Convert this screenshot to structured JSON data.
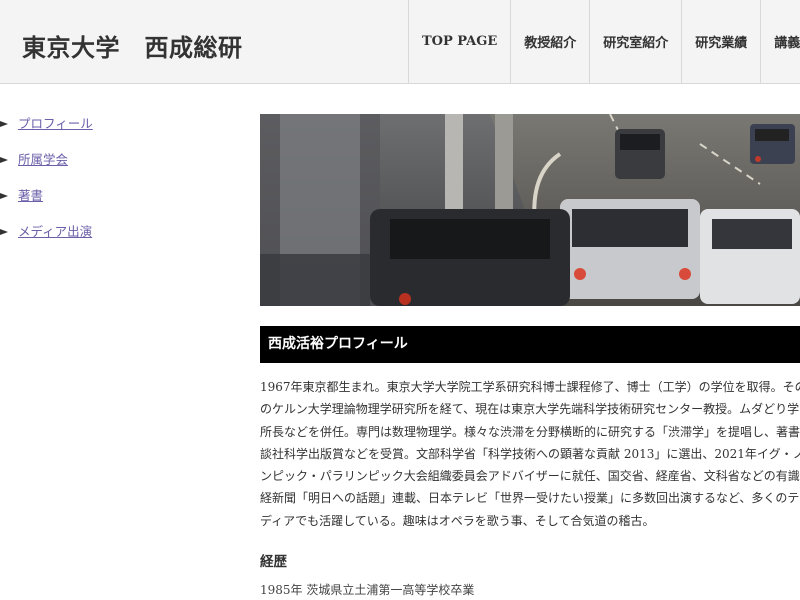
{
  "header": {
    "site_title": "東京大学　西成総研",
    "nav": [
      "TOP PAGE",
      "教授紹介",
      "研究室紹介",
      "研究業績",
      "講義"
    ]
  },
  "sidebar": {
    "items": [
      "プロフィール",
      "所属学会",
      "著書",
      "メディア出演"
    ]
  },
  "hero": {
    "image": "traffic-jam-highway-photo"
  },
  "profile": {
    "heading": "西成活裕プロフィール",
    "bio_lines": [
      "1967年東京都生まれ。東京大学大学院工学系研究科博士課程修了、博士（工学）の学位を取得。その",
      "のケルン大学理論物理学研究所を経て、現在は東京大学先端科学技術研究センター教授。ムダどり学",
      "所長などを併任。専門は数理物理学。様々な渋滞を分野横断的に研究する「渋滞学」を提唱し、著書",
      "談社科学出版賞などを受賞。文部科学省「科学技術への顕著な貢献 2013」に選出、2021年イグ・ノー",
      "ンピック・パラリンピック大会組織委員会アドバイザーに就任、国交省、経産省、文科省などの有識",
      "経新聞「明日への話題」連載、日本テレビ「世界一受けたい授業」に多数回出演するなど、多くのテ",
      "ディアでも活躍している。趣味はオペラを歌う事、そして合気道の稽古。"
    ],
    "career_heading": "経歴",
    "career_items": [
      "1985年 茨城県立土浦第一高等学校卒業"
    ]
  }
}
